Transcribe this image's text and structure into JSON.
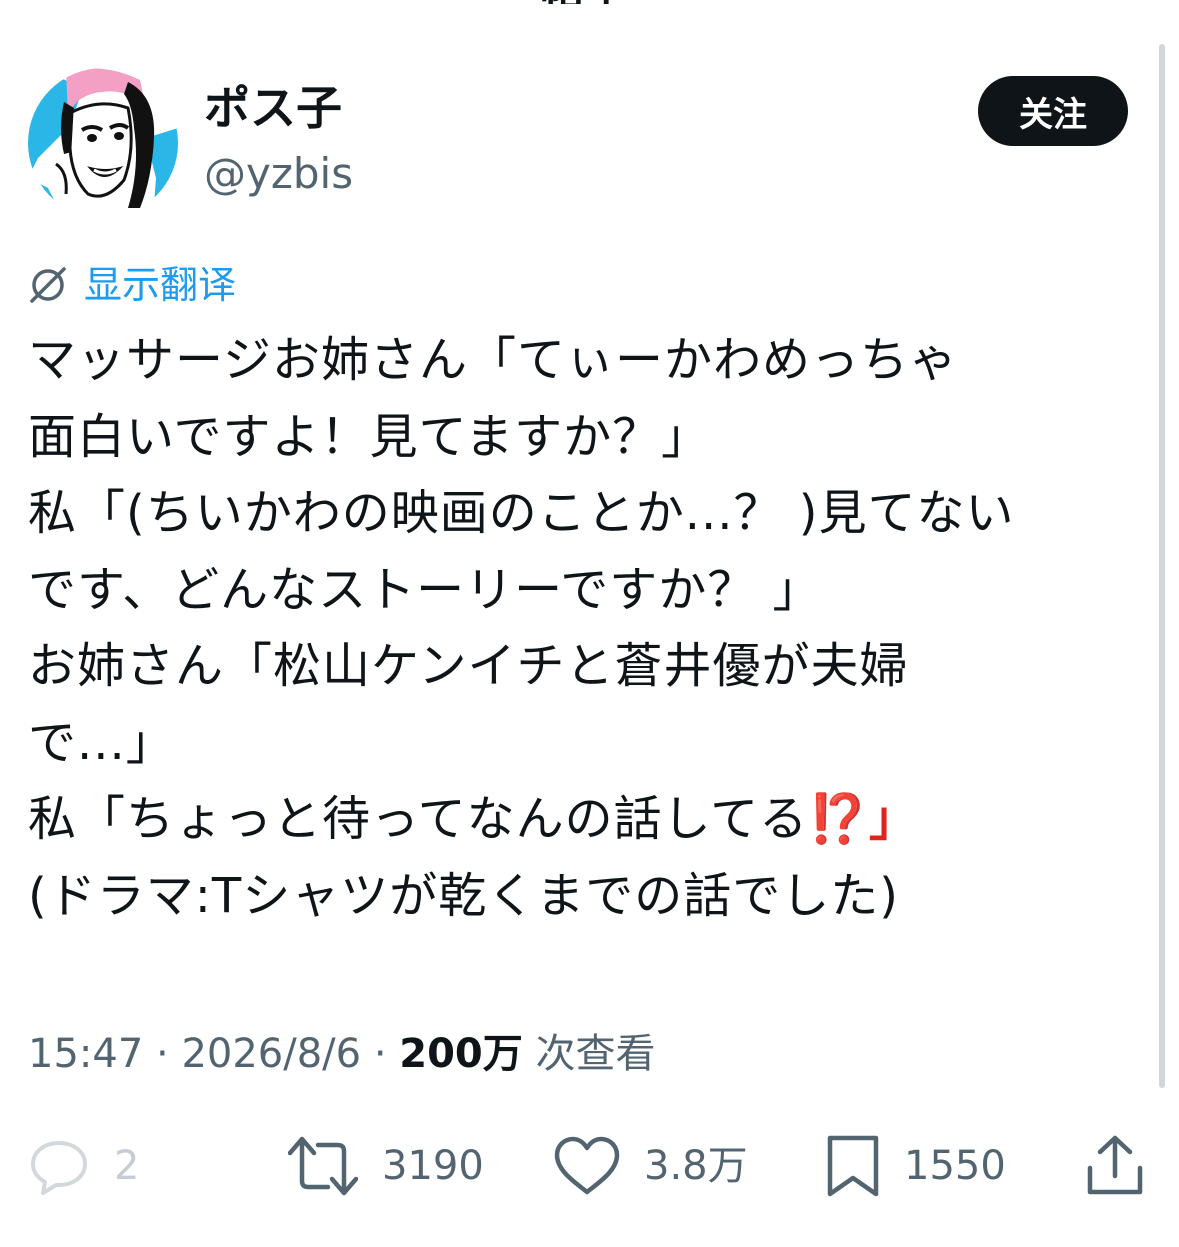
{
  "top_fragment": "帖子",
  "user": {
    "display_name": "ポス子",
    "handle": "@yzbis",
    "follow_label": "关注"
  },
  "translate_label": "显示翻译",
  "tweet_lines": [
    "マッサージお姉さん「てぃーかわめっちゃ",
    "面白いですよ！見てますか？」",
    "私「(ちいかわの映画のことか...？ )見てない",
    "です、どんなストーリーですか？ 」",
    "お姉さん「松山ケンイチと蒼井優が夫婦",
    "で...」",
    "私「ちょっと待ってなんの話してる",
    "(ドラマ:Tシャツが乾くまでの話でした)"
  ],
  "tweet_line7_suffix": "⁉️」",
  "meta": {
    "time": "15:47",
    "separator": "·",
    "date": "2026/8/6",
    "views_count": "200万",
    "views_label": "次查看"
  },
  "actions": {
    "reply": {
      "icon": "reply-icon",
      "count": "2"
    },
    "retweet": {
      "icon": "retweet-icon",
      "count": "3190"
    },
    "like": {
      "icon": "heart-icon",
      "count": "3.8万"
    },
    "bookmark": {
      "icon": "bookmark-icon",
      "count": "1550"
    },
    "share": {
      "icon": "share-icon"
    }
  },
  "colors": {
    "text": "#0f1419",
    "secondary": "#536471",
    "link": "#1d9bf0",
    "follow_bg": "#0f1419",
    "follow_fg": "#ffffff",
    "emoji_red": "#e0241b"
  }
}
